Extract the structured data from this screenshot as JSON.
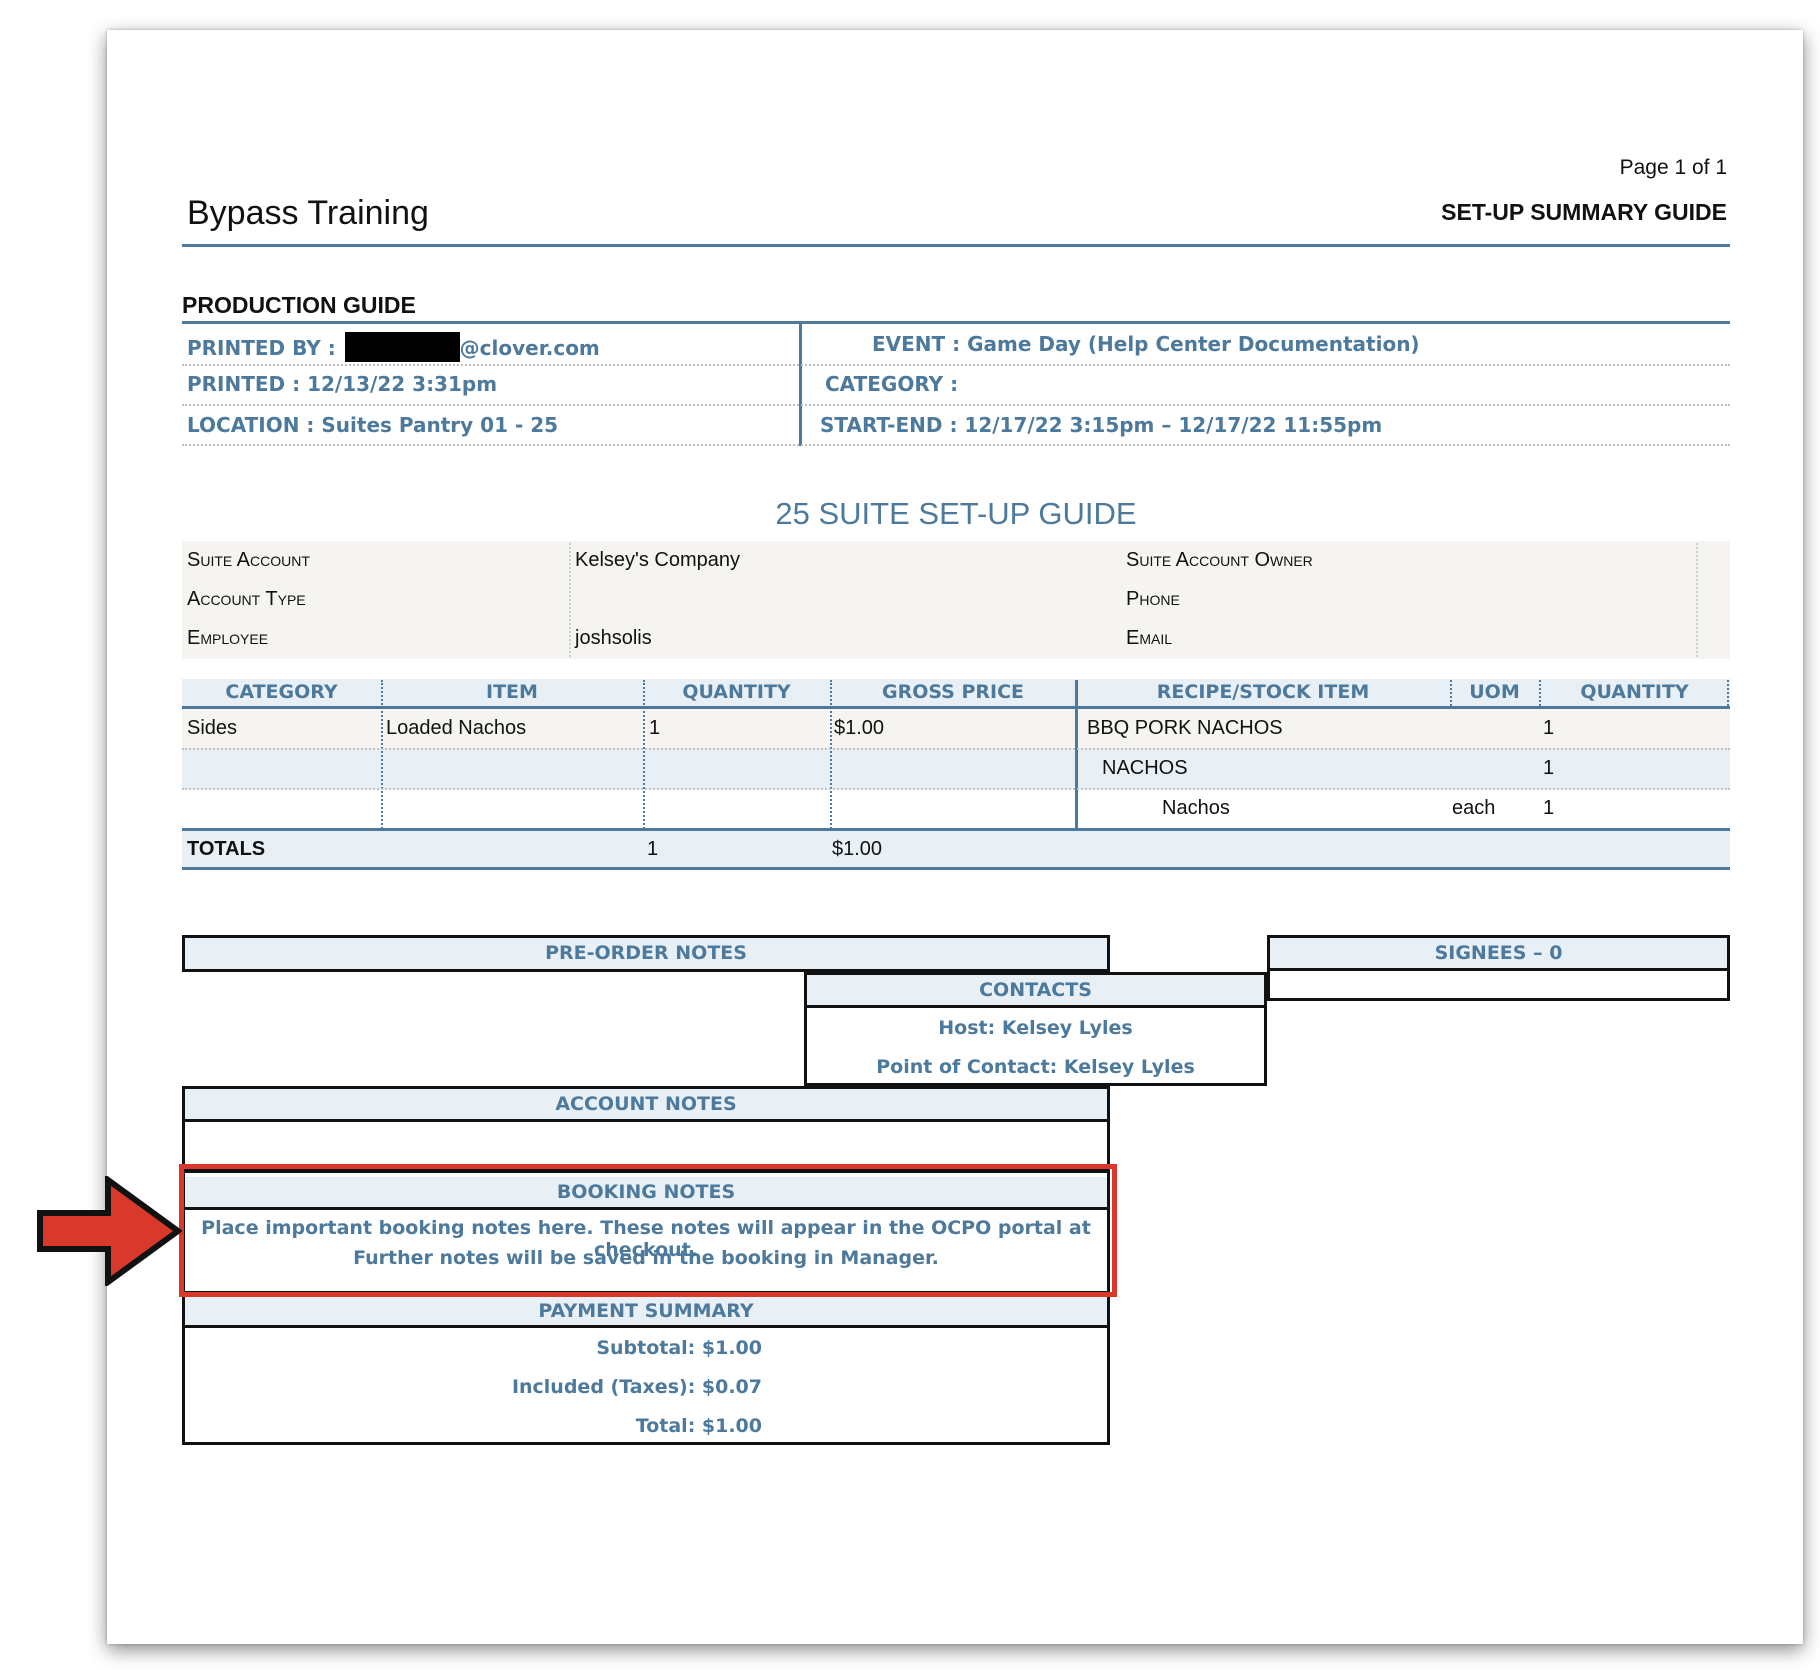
{
  "header": {
    "company": "Bypass Training",
    "page": "Page 1 of 1",
    "doc_title": "SET-UP SUMMARY GUIDE"
  },
  "production": {
    "title": "PRODUCTION GUIDE",
    "printed_by_label": "PRINTED BY :",
    "printed_by_value": "@clover.com",
    "printed_label": "PRINTED :",
    "printed_value": "12/13/22 3:31pm",
    "location_label": "LOCATION :",
    "location_value": "Suites Pantry 01 - 25",
    "event_label": "EVENT :",
    "event_value": "Game Day (Help Center Documentation)",
    "category_label": "CATEGORY :",
    "category_value": "",
    "start_end_label": "START-END :",
    "start_end_value": "12/17/22 3:15pm – 12/17/22 11:55pm"
  },
  "suite": {
    "title": "25 SUITE SET-UP GUIDE",
    "suite_account_label": "Suite Account",
    "suite_account_value": "Kelsey's Company",
    "account_type_label": "Account Type",
    "account_type_value": "",
    "employee_label": "Employee",
    "employee_value": "joshsolis",
    "owner_label": "Suite Account Owner",
    "phone_label": "Phone",
    "email_label": "Email"
  },
  "table": {
    "headers": [
      "CATEGORY",
      "ITEM",
      "QUANTITY",
      "GROSS PRICE",
      "RECIPE/STOCK ITEM",
      "UOM",
      "QUANTITY"
    ],
    "rows": [
      [
        "Sides",
        "Loaded Nachos",
        "1",
        "$1.00",
        "BBQ PORK NACHOS",
        "",
        "1"
      ],
      [
        "",
        "",
        "",
        "",
        "NACHOS",
        "",
        "1"
      ],
      [
        "",
        "",
        "",
        "",
        "Nachos",
        "each",
        "1"
      ]
    ],
    "totals_label": "TOTALS",
    "totals_quantity": "1",
    "totals_price": "$1.00"
  },
  "notes": {
    "pre_order_title": "PRE-ORDER NOTES",
    "signees_title": "SIGNEES – 0",
    "contacts_title": "CONTACTS",
    "host_line": "Host: Kelsey Lyles",
    "poc_line": "Point of Contact: Kelsey Lyles",
    "account_notes_title": "ACCOUNT NOTES",
    "booking_notes_title": "BOOKING NOTES",
    "booking_line1": "Place important booking notes here. These notes will appear in the OCPO portal at checkout.",
    "booking_line2": "Further notes will be saved in the booking in Manager.",
    "payment_title": "PAYMENT SUMMARY",
    "subtotal": "Subtotal: $1.00",
    "taxes": "Included (Taxes): $0.07",
    "total": "Total: $1.00"
  },
  "annotation": {
    "highlight_color": "#d9392b",
    "arrow_color": "#d9392b",
    "arrow_icon": "arrow-right-icon"
  }
}
